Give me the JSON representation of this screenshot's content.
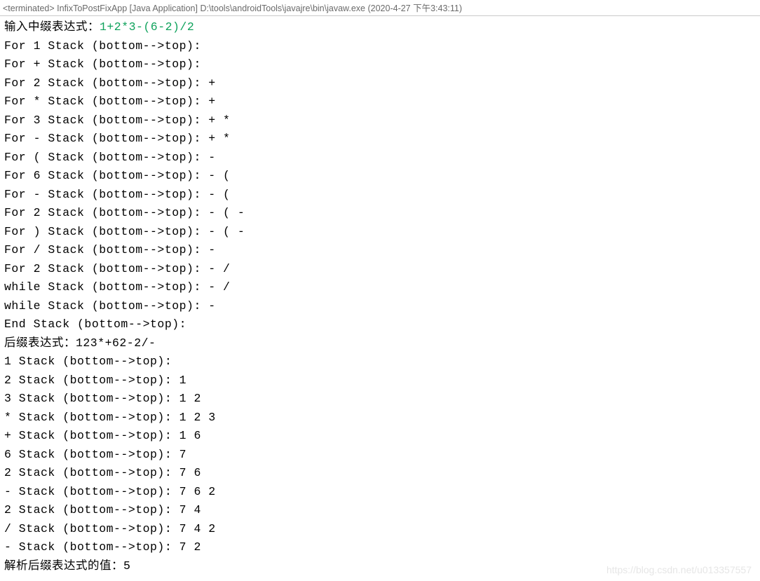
{
  "header": {
    "status": "<terminated>",
    "app": "InfixToPostFixApp [Java Application]",
    "path": "D:\\tools\\androidTools\\javajre\\bin\\javaw.exe",
    "timestamp": "(2020-4-27 下午3:43:11)"
  },
  "prompt": {
    "label": "输入中缀表达式：",
    "input": "1+2*3-(6-2)/2"
  },
  "output_lines": [
    "For 1 Stack (bottom-->top):",
    "For + Stack (bottom-->top):",
    "For 2 Stack (bottom-->top): +",
    "For * Stack (bottom-->top): +",
    "For 3 Stack (bottom-->top): + *",
    "For - Stack (bottom-->top): + *",
    "For ( Stack (bottom-->top): -",
    "For 6 Stack (bottom-->top): - (",
    "For - Stack (bottom-->top): - (",
    "For 2 Stack (bottom-->top): - ( -",
    "For ) Stack (bottom-->top): - ( -",
    "For / Stack (bottom-->top): -",
    "For 2 Stack (bottom-->top): - /",
    "while Stack (bottom-->top): - /",
    "while Stack (bottom-->top): -",
    "End Stack (bottom-->top):",
    "后缀表达式：123*+62-2/-",
    "1 Stack (bottom-->top):",
    "2 Stack (bottom-->top): 1",
    "3 Stack (bottom-->top): 1 2",
    "* Stack (bottom-->top): 1 2 3",
    "+ Stack (bottom-->top): 1 6",
    "6 Stack (bottom-->top): 7",
    "2 Stack (bottom-->top): 7 6",
    "- Stack (bottom-->top): 7 6 2",
    "2 Stack (bottom-->top): 7 4",
    "/ Stack (bottom-->top): 7 4 2",
    "- Stack (bottom-->top): 7 2",
    "解析后缀表达式的值：5"
  ],
  "watermark": "https://blog.csdn.net/u013357557"
}
